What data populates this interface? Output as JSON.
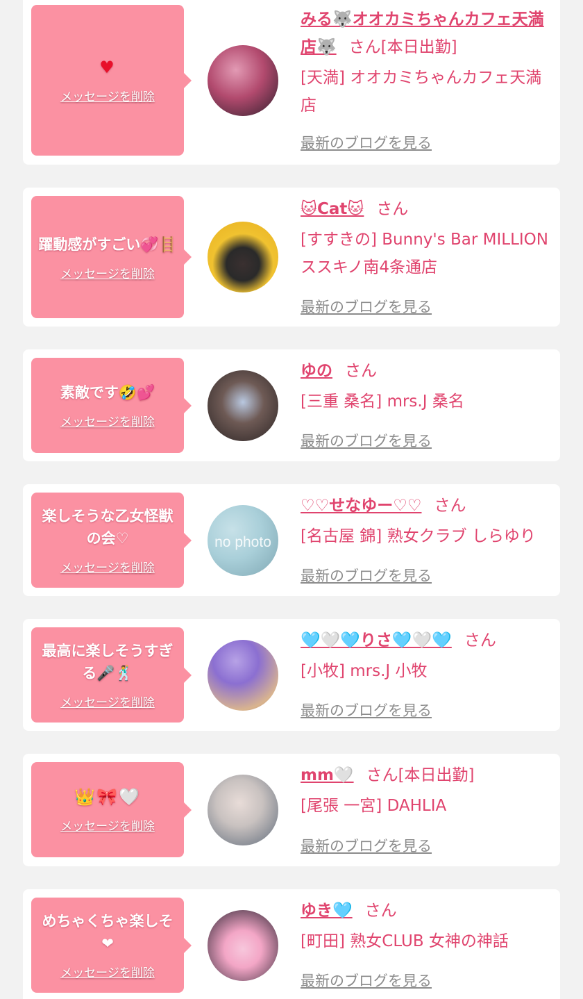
{
  "delete_label": "メッセージを削除",
  "blog_label": "最新のブログを見る",
  "cards": [
    {
      "message": "♥",
      "name": "みる🐺オオカミちゃんカフェ天満店🐺",
      "suffix": "さん[本日出勤]",
      "shop": "[天満] オオカミちゃんカフェ天満店",
      "avatar_colors": [
        "#b24a6e",
        "#2e1f2c"
      ]
    },
    {
      "message": "躍動感がすごい💞🪜",
      "name": "🐱Cat🐱",
      "suffix": "さん",
      "shop": "[すすきの] Bunny's Bar MILLION ススキノ南4条通店",
      "avatar_colors": [
        "#f0c230",
        "#2a2a2a"
      ]
    },
    {
      "message": "素敵です🤣💕",
      "name": "ゆの",
      "suffix": "さん",
      "shop": "[三重 桑名] mrs.J 桑名",
      "avatar_colors": [
        "#6e5a55",
        "#2b2424"
      ]
    },
    {
      "message": "楽しそうな乙女怪獣の会♡",
      "name": "♡♡せなゆー♡♡",
      "suffix": "さん",
      "shop": "[名古屋 錦] 熟女クラブ しらゆり",
      "avatar_colors": [
        "#a9cfd9",
        "#7fa7b3"
      ],
      "avatar_text": "no photo"
    },
    {
      "message": "最高に楽しそうすぎる🎤🕺",
      "name": "🩵🤍🩵りさ🩵🤍🩵",
      "suffix": "さん",
      "shop": "[小牧] mrs.J 小牧",
      "avatar_colors": [
        "#8b6fd1",
        "#d9b48f"
      ]
    },
    {
      "message": "👑🎀🤍",
      "name": "mm🤍",
      "suffix": "さん[本日出勤]",
      "shop": "[尾張 一宮] DAHLIA",
      "avatar_colors": [
        "#c9c2c0",
        "#5e6a7a"
      ]
    },
    {
      "message": "めちゃくちゃ楽しそ❤",
      "name": "ゆき🩵",
      "suffix": "さん",
      "shop": "[町田] 熟女CLUB 女神の神話",
      "avatar_colors": [
        "#f3a6c6",
        "#2a2230"
      ]
    }
  ]
}
